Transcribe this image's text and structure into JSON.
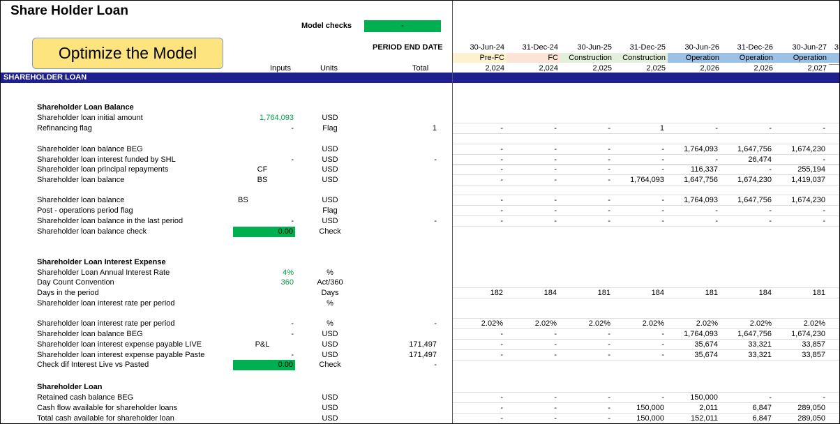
{
  "title": "Share Holder Loan",
  "model_checks": {
    "label": "Model checks",
    "value": "-"
  },
  "optimize_button": "Optimize the Model",
  "period_end_label": "PERIOD END DATE",
  "headers": {
    "inputs": "Inputs",
    "units": "Units",
    "total": "Total"
  },
  "section_band": "SHAREHOLDER LOAN",
  "colors": {
    "band": "#1f1f8f",
    "green": "#00b050",
    "button": "#fde47f",
    "prefc": "#fde9d9",
    "fc": "#fbe4d5",
    "construction": "#e2efda",
    "operation": "#9bc2e6"
  },
  "periods": [
    {
      "date": "30-Jun-24",
      "phase": "Pre-FC",
      "year": "2,024",
      "phase_color": "#fdf2d0"
    },
    {
      "date": "31-Dec-24",
      "phase": "FC",
      "year": "2,024",
      "phase_color": "#fbe4d5"
    },
    {
      "date": "30-Jun-25",
      "phase": "Construction",
      "year": "2,025",
      "phase_color": "#e2efda"
    },
    {
      "date": "31-Dec-25",
      "phase": "Construction",
      "year": "2,025",
      "phase_color": "#e2efda"
    },
    {
      "date": "30-Jun-26",
      "phase": "Operation",
      "year": "2,026",
      "phase_color": "#9bc2e6"
    },
    {
      "date": "31-Dec-26",
      "phase": "Operation",
      "year": "2,026",
      "phase_color": "#9bc2e6"
    },
    {
      "date": "30-Jun-27",
      "phase": "Operation",
      "year": "2,027",
      "phase_color": "#9bc2e6"
    },
    {
      "date": "3",
      "phase": "",
      "year": "",
      "phase_color": "#9bc2e6"
    }
  ],
  "rows": [
    {
      "label": "Shareholder Loan Balance",
      "bold": true
    },
    {
      "label": "Shareholder loan initial amount",
      "input": "1,764,093",
      "input_style": "green",
      "unit": "USD"
    },
    {
      "label": "Refinancing flag",
      "input": "-",
      "unit": "Flag",
      "total": "1",
      "vals": [
        "-",
        "-",
        "-",
        "1",
        "-",
        "-",
        "-"
      ]
    },
    {
      "label": "Shareholder loan balance BEG",
      "unit": "USD",
      "vals": [
        "-",
        "-",
        "-",
        "-",
        "1,764,093",
        "1,647,756",
        "1,674,230"
      ]
    },
    {
      "label": "Shareholder loan interest funded by SHL",
      "input": "-",
      "unit": "USD",
      "total": "-",
      "vals": [
        "-",
        "-",
        "-",
        "-",
        "-",
        "26,474",
        "-"
      ]
    },
    {
      "label": "Shareholder loan principal repayments",
      "input": "CF",
      "input_style": "center",
      "unit": "USD",
      "vals": [
        "-",
        "-",
        "-",
        "-",
        "116,337",
        "-",
        "255,194"
      ]
    },
    {
      "label": "Shareholder loan balance",
      "input": "BS",
      "input_style": "center",
      "unit": "USD",
      "vals": [
        "-",
        "-",
        "-",
        "1,764,093",
        "1,647,756",
        "1,674,230",
        "1,419,037"
      ]
    },
    {
      "label": "Shareholder loan balance",
      "bs": "BS",
      "unit": "USD",
      "vals": [
        "-",
        "-",
        "-",
        "-",
        "1,764,093",
        "1,647,756",
        "1,674,230"
      ]
    },
    {
      "label": "Post - operations period flag",
      "unit": "Flag",
      "vals": [
        "-",
        "-",
        "-",
        "-",
        "-",
        "-",
        "-"
      ]
    },
    {
      "label": "Shareholder loan balance in the last period",
      "input": "-",
      "unit": "USD",
      "total": "-",
      "vals": [
        "-",
        "-",
        "-",
        "-",
        "-",
        "-",
        "-"
      ]
    },
    {
      "label": "Shareholder loan balance check",
      "input": "0.00",
      "input_style": "box",
      "unit": "Check"
    },
    {
      "label": "Shareholder Loan Interest Expense",
      "bold": true
    },
    {
      "label": "Shareholder Loan Annual Interest Rate",
      "input": "4%",
      "input_style": "green",
      "unit": "%"
    },
    {
      "label": "Day Count Convention",
      "input": "360",
      "input_style": "green",
      "unit": "Act/360"
    },
    {
      "label": "Days in the period",
      "unit": "Days",
      "vals": [
        "182",
        "184",
        "181",
        "184",
        "181",
        "184",
        "181"
      ]
    },
    {
      "label": "Shareholder loan interest rate per period",
      "unit": "%"
    },
    {
      "label": "Shareholder loan interest rate per period",
      "input": "-",
      "unit": "%",
      "total": "-",
      "vals": [
        "2.02%",
        "2.02%",
        "2.02%",
        "2.02%",
        "2.02%",
        "2.02%",
        "2.02%"
      ]
    },
    {
      "label": "Shareholder loan balance BEG",
      "input": "-",
      "unit": "USD",
      "vals": [
        "-",
        "-",
        "-",
        "-",
        "1,764,093",
        "1,647,756",
        "1,674,230"
      ]
    },
    {
      "label": "Shareholder loan interest expense payable LIVE",
      "input": "P&L",
      "input_style": "center",
      "unit": "USD",
      "total": "171,497",
      "vals": [
        "-",
        "-",
        "-",
        "-",
        "35,674",
        "33,321",
        "33,857"
      ]
    },
    {
      "label": "Shareholder loan interest expense payable Paste",
      "input": "-",
      "unit": "USD",
      "total": "171,497",
      "vals": [
        "-",
        "-",
        "-",
        "-",
        "35,674",
        "33,321",
        "33,857"
      ]
    },
    {
      "label": "Check dif Interest Live vs Pasted",
      "input": "0.00",
      "input_style": "box",
      "unit": "Check",
      "total": "-"
    },
    {
      "label": "Shareholder Loan",
      "bold": true
    },
    {
      "label": "Retained cash balance BEG",
      "unit": "USD",
      "vals": [
        "-",
        "-",
        "-",
        "-",
        "150,000",
        "-",
        "-"
      ]
    },
    {
      "label": "Cash flow available for shareholder loans",
      "unit": "USD",
      "vals": [
        "-",
        "-",
        "-",
        "150,000",
        "2,011",
        "6,847",
        "289,050"
      ]
    },
    {
      "label": "Total cash available for shareholder loan",
      "unit": "USD",
      "vals": [
        "-",
        "-",
        "-",
        "150,000",
        "152,011",
        "6,847",
        "289,050"
      ]
    }
  ]
}
